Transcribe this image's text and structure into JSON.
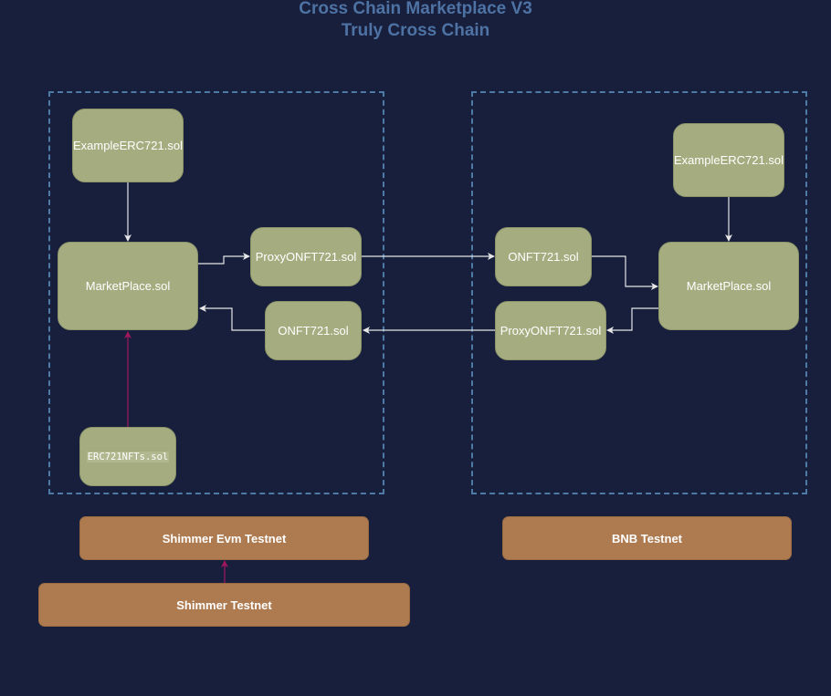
{
  "title": {
    "line1": "Cross Chain Marketplace V3",
    "line2": "Truly Cross Chain"
  },
  "colors": {
    "background": "#171f3c",
    "title": "#4d72a3",
    "group_border": "#4f7aa5",
    "contract_node": "#a5ad80",
    "network_node": "#ae7b50",
    "edge": "#e6e6e6",
    "edge_dependency": "#a0175e"
  },
  "left_chain": {
    "nodes": {
      "example_erc721": "ExampleERC721.sol",
      "marketplace": "MarketPlace.sol",
      "proxy_onft721": "ProxyONFT721.sol",
      "onft721": "ONFT721.sol",
      "erc721nfts": "ERC721NFTs.sol"
    },
    "network": "Shimmer Evm Testnet",
    "base_network": "Shimmer Testnet"
  },
  "right_chain": {
    "nodes": {
      "example_erc721": "ExampleERC721.sol",
      "marketplace": "MarketPlace.sol",
      "onft721": "ONFT721.sol",
      "proxy_onft721": "ProxyONFT721.sol"
    },
    "network": "BNB Testnet"
  },
  "edges": [
    {
      "from": "left.ExampleERC721.sol",
      "to": "left.MarketPlace.sol",
      "style": "solid"
    },
    {
      "from": "left.MarketPlace.sol",
      "to": "left.ProxyONFT721.sol",
      "style": "solid"
    },
    {
      "from": "left.ProxyONFT721.sol",
      "to": "right.ONFT721.sol",
      "style": "solid"
    },
    {
      "from": "right.ONFT721.sol",
      "to": "right.MarketPlace.sol",
      "style": "solid"
    },
    {
      "from": "right.ExampleERC721.sol",
      "to": "right.MarketPlace.sol",
      "style": "solid"
    },
    {
      "from": "right.MarketPlace.sol",
      "to": "right.ProxyONFT721.sol",
      "style": "solid"
    },
    {
      "from": "right.ProxyONFT721.sol",
      "to": "left.ONFT721.sol",
      "style": "solid"
    },
    {
      "from": "left.ONFT721.sol",
      "to": "left.MarketPlace.sol",
      "style": "solid"
    },
    {
      "from": "left.ERC721NFTs.sol",
      "to": "left.MarketPlace.sol",
      "style": "dependency"
    },
    {
      "from": "Shimmer Testnet",
      "to": "Shimmer Evm Testnet",
      "style": "dependency"
    }
  ]
}
